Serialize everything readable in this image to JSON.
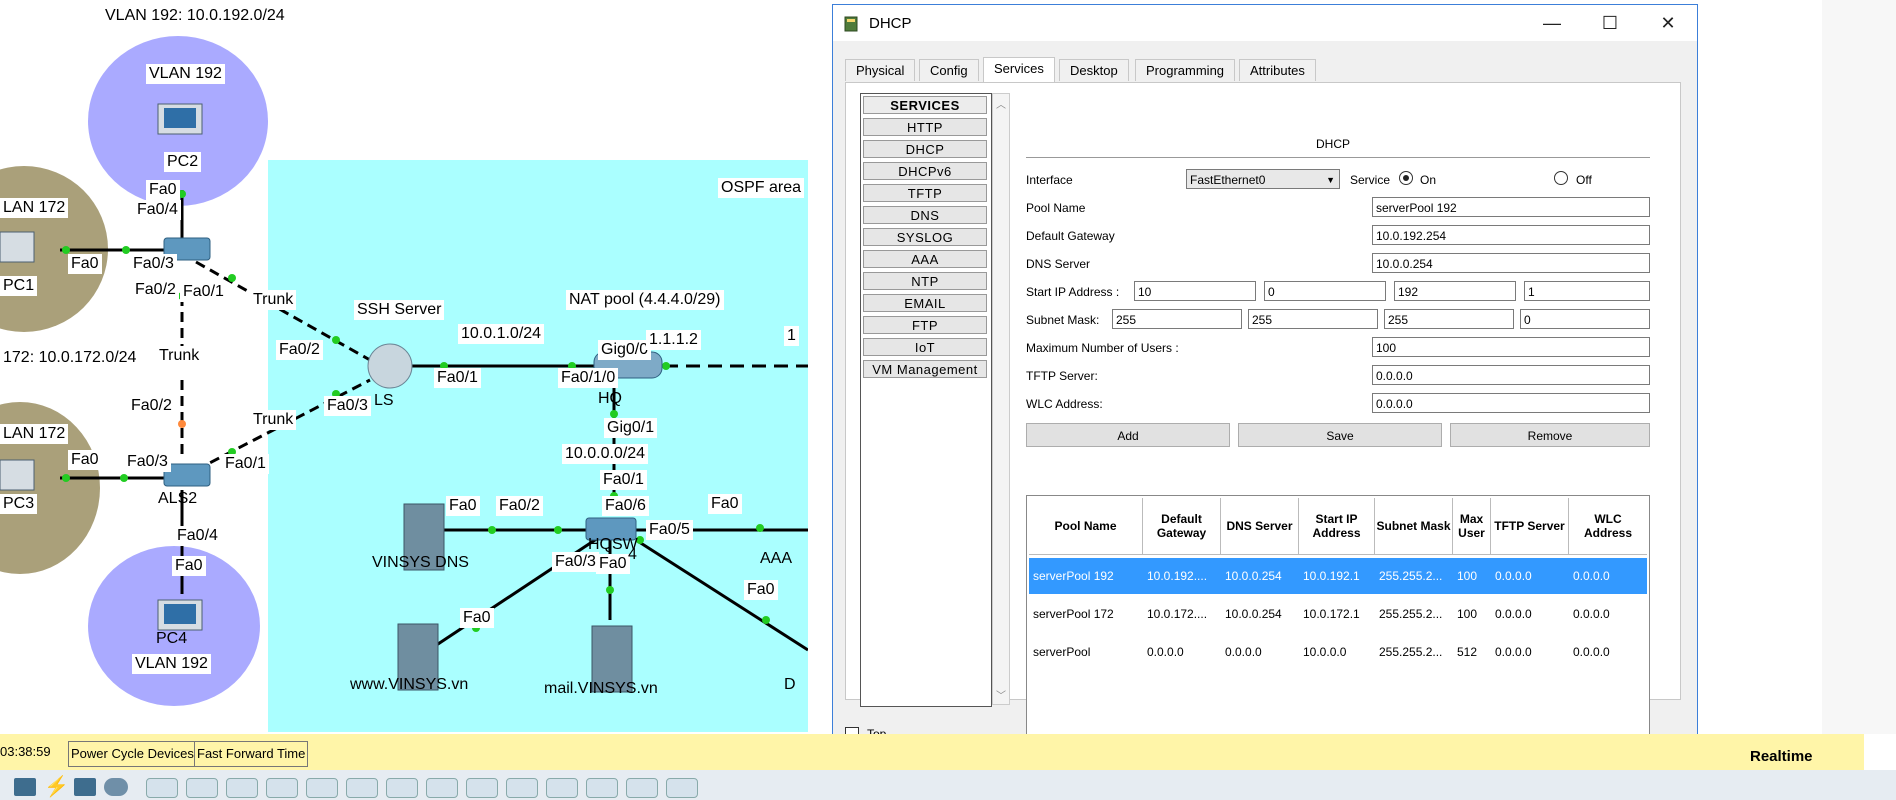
{
  "window": {
    "title": "DHCP",
    "controls": {
      "minimize": "—",
      "maximize": "☐",
      "close": "✕"
    }
  },
  "tabs": [
    {
      "label": "Physical",
      "active": false
    },
    {
      "label": "Config",
      "active": false
    },
    {
      "label": "Services",
      "active": true
    },
    {
      "label": "Desktop",
      "active": false
    },
    {
      "label": "Programming",
      "active": false
    },
    {
      "label": "Attributes",
      "active": false
    }
  ],
  "services": {
    "header": "SERVICES",
    "items": [
      "HTTP",
      "DHCP",
      "DHCPv6",
      "TFTP",
      "DNS",
      "SYSLOG",
      "AAA",
      "NTP",
      "EMAIL",
      "FTP",
      "IoT",
      "VM Management"
    ]
  },
  "dhcp": {
    "section_title": "DHCP",
    "interface_label": "Interface",
    "interface_value": "FastEthernet0",
    "service_label": "Service",
    "on_label": "On",
    "off_label": "Off",
    "service_state": "On",
    "pool_name_label": "Pool Name",
    "pool_name_value": "serverPool 192",
    "gateway_label": "Default Gateway",
    "gateway_value": "10.0.192.254",
    "dns_label": "DNS Server",
    "dns_value": "10.0.0.254",
    "start_ip_label": "Start IP Address :",
    "start_ip": [
      "10",
      "0",
      "192",
      "1"
    ],
    "mask_label": "Subnet Mask:",
    "mask": [
      "255",
      "255",
      "255",
      "0"
    ],
    "max_users_label": "Maximum Number of Users :",
    "max_users_value": "100",
    "tftp_label": "TFTP Server:",
    "tftp_value": "0.0.0.0",
    "wlc_label": "WLC Address:",
    "wlc_value": "0.0.0.0",
    "add_label": "Add",
    "save_label": "Save",
    "remove_label": "Remove"
  },
  "pool_table": {
    "headers": [
      "Pool Name",
      "Default Gateway",
      "DNS Server",
      "Start IP Address",
      "Subnet Mask",
      "Max User",
      "TFTP Server",
      "WLC Address"
    ],
    "rows": [
      [
        "serverPool 192",
        "10.0.192....",
        "10.0.0.254",
        "10.0.192.1",
        "255.255.2...",
        "100",
        "0.0.0.0",
        "0.0.0.0"
      ],
      [
        "serverPool 172",
        "10.0.172....",
        "10.0.0.254",
        "10.0.172.1",
        "255.255.2...",
        "100",
        "0.0.0.0",
        "0.0.0.0"
      ],
      [
        "serverPool",
        "0.0.0.0",
        "0.0.0.0",
        "10.0.0.0",
        "255.255.2...",
        "512",
        "0.0.0.0",
        "0.0.0.0"
      ]
    ]
  },
  "top_checkbox_label": "Top",
  "status_bar": {
    "time": "03:38:59",
    "power_cycle": "Power Cycle Devices",
    "fast_forward": "Fast Forward Time",
    "mode": "Realtime"
  },
  "topology": {
    "labels": {
      "vlan192_net": "VLAN 192: 10.0.192.0/24",
      "vlan172_net": "172: 10.0.172.0/24",
      "vlan192_a": "VLAN 192",
      "vlan192_b": "VLAN 192",
      "vlan172_a": "LAN 172",
      "vlan172_b": "LAN 172",
      "pc2": "PC2",
      "pc1": "PC1",
      "pc3": "PC3",
      "pc4": "PC4",
      "ls": "LS",
      "hq": "HQ",
      "als2": "ALS2",
      "hqsw": "HQSW",
      "ssh_server": "SSH Server",
      "ospf": "OSPF area",
      "nat_pool": "NAT pool (4.4.4.0/29)",
      "net_10_0_1": "10.0.1.0/24",
      "net_10_0_0": "10.0.0.0/24",
      "ip_1_1_1_2": "1.1.1.2",
      "vinsys_dns": "VINSYS DNS",
      "www": "www.VINSYS.vn",
      "mail": "mail.VINSYS.vn",
      "aaa": "AAA",
      "trunk": "Trunk",
      "fa0": "Fa0",
      "fa0_4": "Fa0/4",
      "fa0_3": "Fa0/3",
      "fa0_2": "Fa0/2",
      "fa0_1": "Fa0/1",
      "fa0_6": "Fa0/6",
      "fa0_5": "Fa0/5",
      "fa0_1_0": "Fa0/1/0",
      "gig0_0": "Gig0/0",
      "gig0_1": "Gig0/1",
      "d_label": "D",
      "one_label": "1",
      "four_label": "4"
    }
  },
  "colors": {
    "ospf_area": "#aaffff",
    "vlan192": "#aaaaff",
    "vlan172": "#aaa07a",
    "selected_row": "#3399ff",
    "status_bar": "#fff5a8"
  }
}
